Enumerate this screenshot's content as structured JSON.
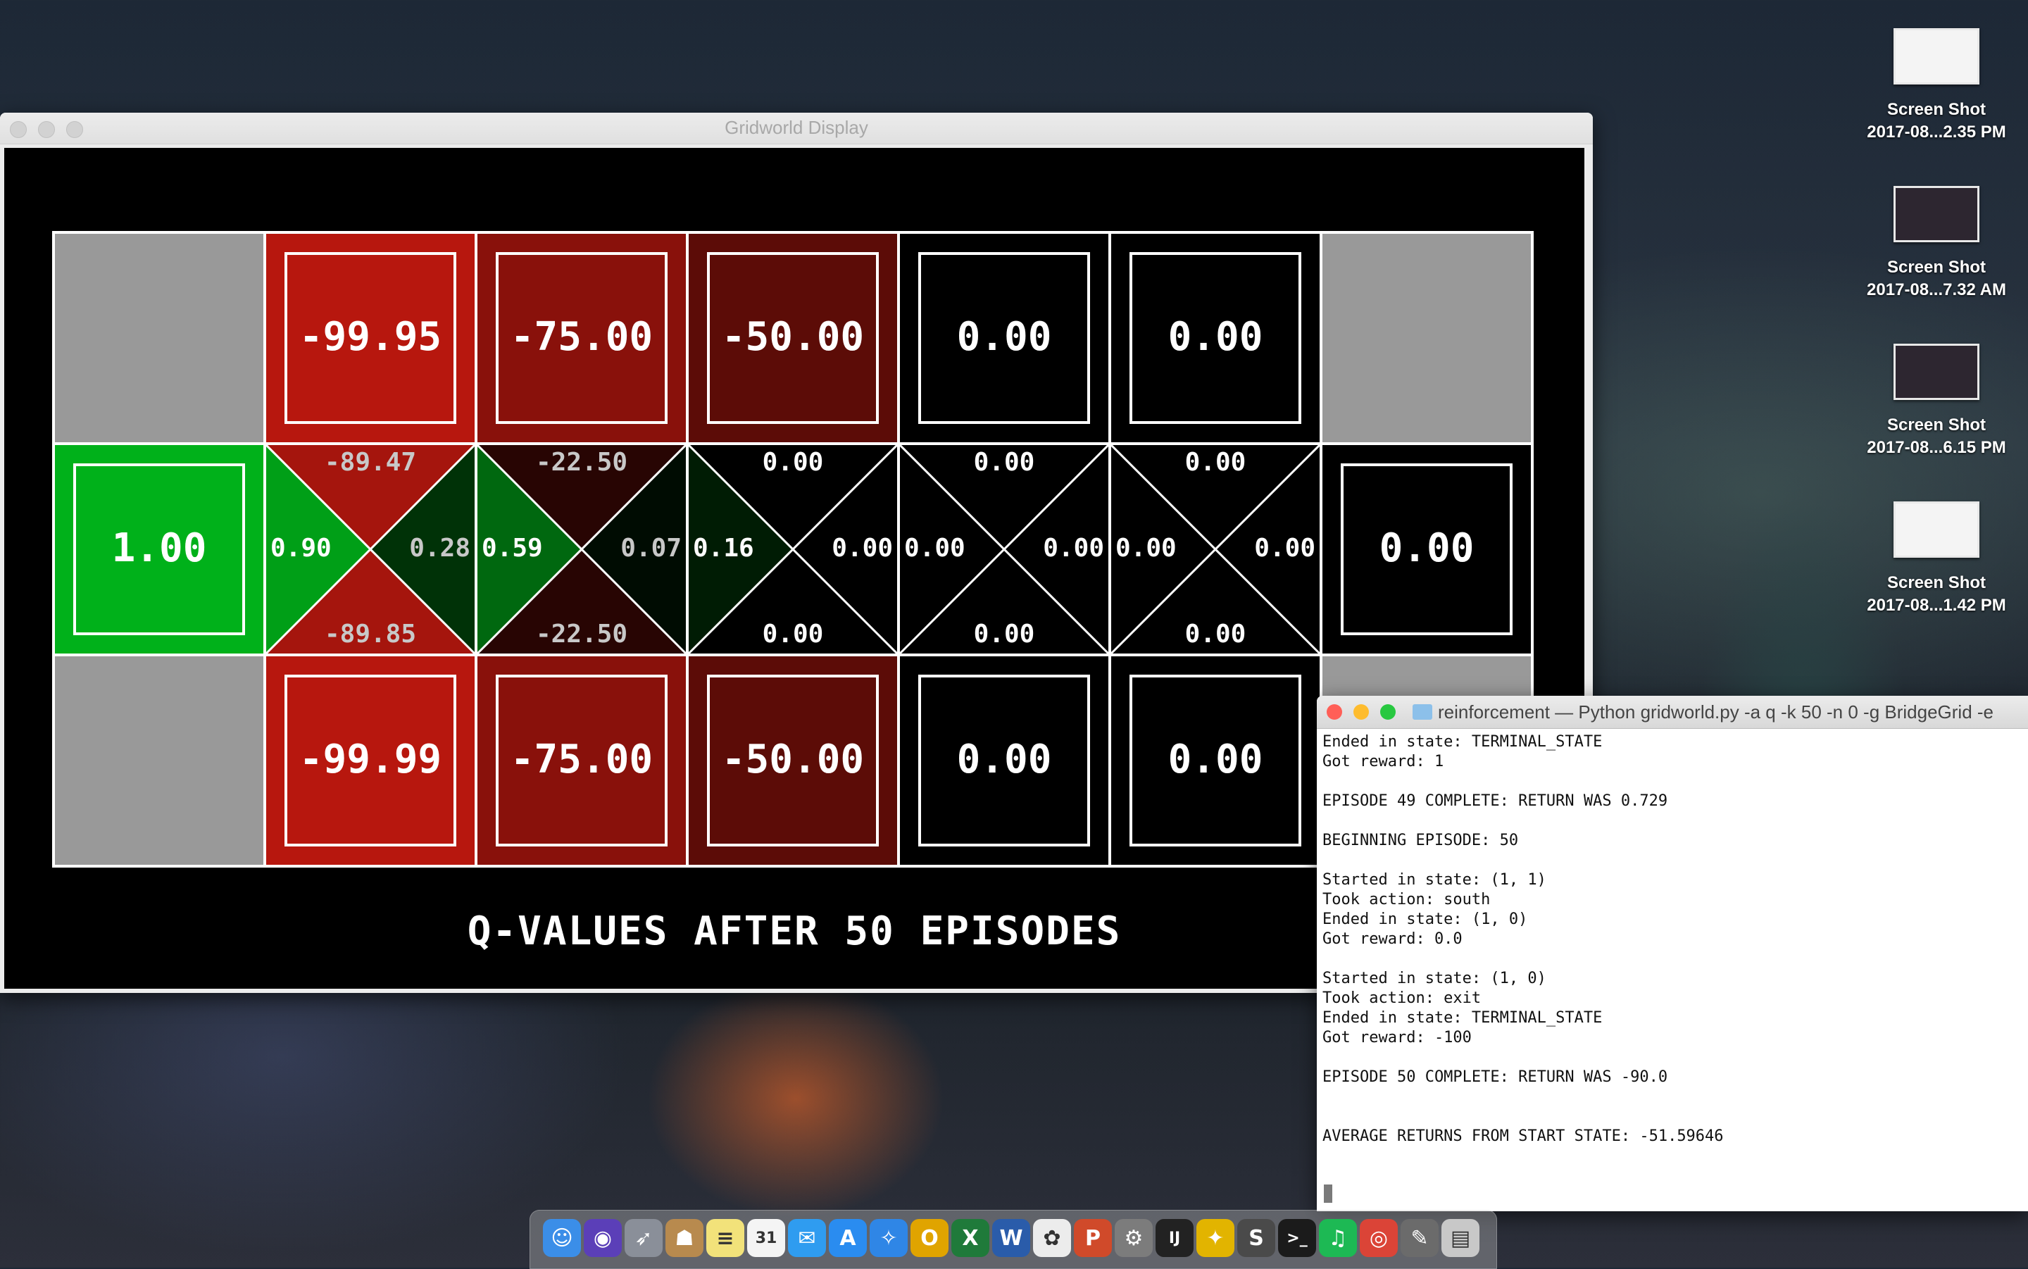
{
  "desktop": {
    "icons": [
      {
        "line1": "Screen Shot",
        "line2": "2017-08...2.35 PM"
      },
      {
        "line1": "Screen Shot",
        "line2": "2017-08...7.32 AM"
      },
      {
        "line1": "Screen Shot",
        "line2": "2017-08...6.15 PM"
      },
      {
        "line1": "Screen Shot",
        "line2": "2017-08...1.42 PM"
      }
    ]
  },
  "gridworld": {
    "window_title": "Gridworld Display",
    "footer": "Q-VALUES AFTER 50 EPISODES",
    "colors": {
      "grey": "#999999",
      "green": "#00b11a",
      "red": "#b7170e",
      "white": "#ffffff"
    },
    "rows": [
      [
        {
          "kind": "wall"
        },
        {
          "kind": "value",
          "value": "-99.95",
          "intensity": -1.0
        },
        {
          "kind": "value",
          "value": "-75.00",
          "intensity": -0.75
        },
        {
          "kind": "value",
          "value": "-50.00",
          "intensity": -0.5
        },
        {
          "kind": "value",
          "value": "0.00",
          "intensity": 0
        },
        {
          "kind": "value",
          "value": "0.00",
          "intensity": 0
        },
        {
          "kind": "wall"
        }
      ],
      [
        {
          "kind": "value",
          "value": "1.00",
          "intensity": 1.0
        },
        {
          "kind": "q",
          "north": "-89.47",
          "south": "-89.85",
          "west": "0.90",
          "east": "0.28",
          "inorth": -0.9,
          "isouth": -0.9,
          "iwest": 0.9,
          "ieast": 0.28
        },
        {
          "kind": "q",
          "north": "-22.50",
          "south": "-22.50",
          "west": "0.59",
          "east": "0.07",
          "inorth": -0.22,
          "isouth": -0.22,
          "iwest": 0.59,
          "ieast": 0.07
        },
        {
          "kind": "q",
          "north": "0.00",
          "south": "0.00",
          "west": "0.16",
          "east": "0.00",
          "inorth": 0,
          "isouth": 0,
          "iwest": 0.16,
          "ieast": 0
        },
        {
          "kind": "q",
          "north": "0.00",
          "south": "0.00",
          "west": "0.00",
          "east": "0.00",
          "inorth": 0,
          "isouth": 0,
          "iwest": 0,
          "ieast": 0
        },
        {
          "kind": "q",
          "north": "0.00",
          "south": "0.00",
          "west": "0.00",
          "east": "0.00",
          "inorth": 0,
          "isouth": 0,
          "iwest": 0,
          "ieast": 0
        },
        {
          "kind": "value",
          "value": "0.00",
          "intensity": 0
        }
      ],
      [
        {
          "kind": "wall"
        },
        {
          "kind": "value",
          "value": "-99.99",
          "intensity": -1.0
        },
        {
          "kind": "value",
          "value": "-75.00",
          "intensity": -0.75
        },
        {
          "kind": "value",
          "value": "-50.00",
          "intensity": -0.5
        },
        {
          "kind": "value",
          "value": "0.00",
          "intensity": 0
        },
        {
          "kind": "value",
          "value": "0.00",
          "intensity": 0
        },
        {
          "kind": "wall"
        }
      ]
    ]
  },
  "terminal": {
    "title": "reinforcement — Python gridworld.py -a q -k 50 -n 0 -g BridgeGrid -e",
    "lines": [
      "Ended in state: TERMINAL_STATE",
      "Got reward: 1",
      "",
      "EPISODE 49 COMPLETE: RETURN WAS 0.729",
      "",
      "BEGINNING EPISODE: 50",
      "",
      "Started in state: (1, 1)",
      "Took action: south",
      "Ended in state: (1, 0)",
      "Got reward: 0.0",
      "",
      "Started in state: (1, 0)",
      "Took action: exit",
      "Ended in state: TERMINAL_STATE",
      "Got reward: -100",
      "",
      "EPISODE 50 COMPLETE: RETURN WAS -90.0",
      "",
      "",
      "AVERAGE RETURNS FROM START STATE: -51.59646"
    ]
  },
  "dock": {
    "apps": [
      {
        "name": "finder-icon",
        "glyph": "☺",
        "color": "#3b8ee8"
      },
      {
        "name": "siri-icon",
        "glyph": "◉",
        "color": "#5b3fb8"
      },
      {
        "name": "launchpad-icon",
        "glyph": "➶",
        "color": "#8a8f99"
      },
      {
        "name": "contacts-icon",
        "glyph": "☗",
        "color": "#b88a4e"
      },
      {
        "name": "notes-icon",
        "glyph": "≡",
        "color": "#f2e27a"
      },
      {
        "name": "calendar-icon",
        "glyph": "31",
        "color": "#f4f4f4"
      },
      {
        "name": "messages-icon",
        "glyph": "✉",
        "color": "#2f9cf0"
      },
      {
        "name": "appstore-icon",
        "glyph": "A",
        "color": "#2a8cf0"
      },
      {
        "name": "safari-icon",
        "glyph": "✧",
        "color": "#2f86e6"
      },
      {
        "name": "outlook-icon",
        "glyph": "O",
        "color": "#e0a400"
      },
      {
        "name": "excel-icon",
        "glyph": "X",
        "color": "#1f7a3a"
      },
      {
        "name": "word-icon",
        "glyph": "W",
        "color": "#2a5caa"
      },
      {
        "name": "photos-icon",
        "glyph": "✿",
        "color": "#ececec"
      },
      {
        "name": "powerpoint-icon",
        "glyph": "P",
        "color": "#d04a2a"
      },
      {
        "name": "preferences-icon",
        "glyph": "⚙",
        "color": "#7c7c7c"
      },
      {
        "name": "intellij-icon",
        "glyph": "IJ",
        "color": "#222222"
      },
      {
        "name": "cyberduck-icon",
        "glyph": "✦",
        "color": "#e2b400"
      },
      {
        "name": "sublime-icon",
        "glyph": "S",
        "color": "#4a4a4a"
      },
      {
        "name": "terminal-icon",
        "glyph": ">_",
        "color": "#1b1b1b"
      },
      {
        "name": "spotify-icon",
        "glyph": "♫",
        "color": "#1db954"
      },
      {
        "name": "chrome-icon",
        "glyph": "◎",
        "color": "#db4437"
      },
      {
        "name": "pencil-icon",
        "glyph": "✎",
        "color": "#6b6b6b"
      },
      {
        "name": "trash-icon",
        "glyph": "▤",
        "color": "#c8c8c8"
      }
    ]
  }
}
